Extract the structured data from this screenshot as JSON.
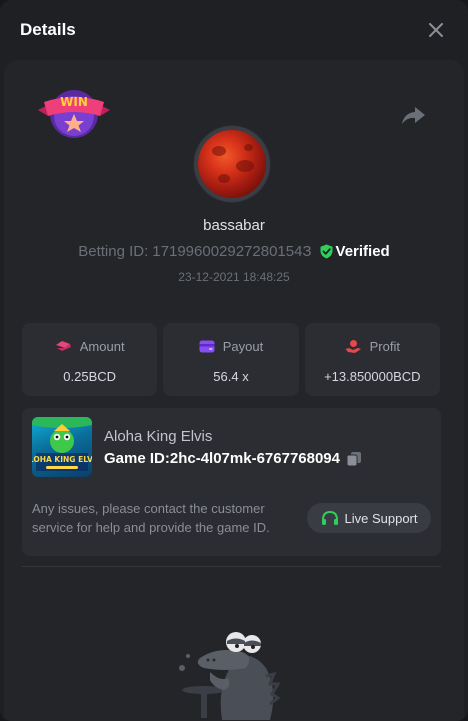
{
  "header": {
    "title": "Details"
  },
  "user": {
    "name": "bassabar"
  },
  "bet": {
    "id_label": "Betting ID:",
    "id": "171996002927280154З",
    "verified_label": "Verified",
    "timestamp": "23-12-2021 18:48:25"
  },
  "stats": [
    {
      "label": "Amount",
      "value": "0.25BCD",
      "icon": "coins-icon",
      "color": "#e8457c"
    },
    {
      "label": "Payout",
      "value": "56.4 x",
      "icon": "wallet-icon",
      "color": "#8a4cf5"
    },
    {
      "label": "Profit",
      "value": "+13.850000BCD",
      "icon": "hand-coin-icon",
      "color": "#e8484c"
    }
  ],
  "game": {
    "name": "Aloha King Elvis",
    "id_label": "Game ID:",
    "id": "2hc-4l07mk-6767768094",
    "thumb_title": "ALOHA KING ELVIS"
  },
  "support": {
    "message": "Any issues, please contact the customer service for help and provide the game ID.",
    "button_label": "Live Support"
  },
  "badge": {
    "text": "WIN"
  },
  "colors": {
    "verified": "#2fcf5a",
    "support_icon": "#2fcf5a"
  }
}
